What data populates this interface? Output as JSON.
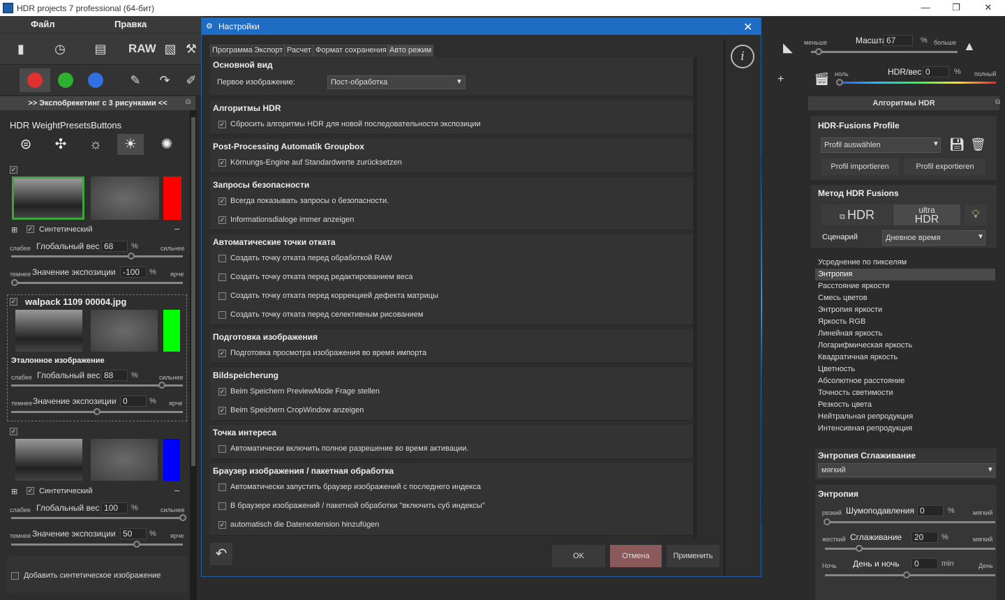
{
  "window": {
    "title": "HDR projects 7 professional (64-бит)",
    "minimize": "—",
    "restore": "❐",
    "close": "✕"
  },
  "menu": {
    "file": "Файл",
    "edit": "Правка"
  },
  "toolbar": {
    "raw_label": "RAW"
  },
  "left": {
    "expo_header": ">> Экспобрекетинг с 3 рисунками <<",
    "presets_title": "HDR WeightPresetsButtons",
    "image1": {
      "synthetic_label": "Синтетический",
      "weaker": "слабее",
      "stronger": "сильнее",
      "global_weight_label": "Глобальный вес",
      "global_weight": "68",
      "pct": "%",
      "darker": "темнее",
      "brighter": "ярче",
      "exposure_label": "Значение экспозиции",
      "exposure": "-100",
      "weight_fraction": 0.7,
      "exposure_fraction": 0.02
    },
    "image2": {
      "filename": "walpack 1109 00004.jpg",
      "reference_label": "Эталонное изображение",
      "weaker": "слабее",
      "stronger": "сильнее",
      "global_weight_label": "Глобальный вес",
      "global_weight": "88",
      "pct": "%",
      "darker": "темнее",
      "brighter": "ярче",
      "exposure_label": "Значение экспозиции",
      "exposure": "0",
      "weight_fraction": 0.88,
      "exposure_fraction": 0.5
    },
    "image3": {
      "synthetic_label": "Синтетический",
      "weaker": "слабее",
      "stronger": "сильнее",
      "global_weight_label": "Глобальный вес",
      "global_weight": "100",
      "pct": "%",
      "darker": "темнее",
      "brighter": "ярче",
      "exposure_label": "Значение экспозиции",
      "exposure": "50",
      "weight_fraction": 1.0,
      "exposure_fraction": 0.73
    },
    "add_synthetic": "Добавить синтетическое изображение"
  },
  "right": {
    "less": "меньше",
    "more": "больше",
    "scale_label": "Масштаб",
    "scale_value": "67",
    "pct": "%",
    "zero": "ноль",
    "full": "полный",
    "hdr_weight_label": "HDR/вес",
    "hdr_weight_value": "0",
    "algorithms_header": "Алгоритмы HDR",
    "profile_title": "HDR-Fusions Profile",
    "profile_select": "Profil auswählen",
    "profile_import": "Profil importieren",
    "profile_export": "Profil exportieren",
    "method_title": "Метод HDR Fusions",
    "method_hdr": "HDR",
    "method_ultra": "ultra",
    "method_ultra_hdr": "HDR",
    "scenario_label": "Сценарий",
    "scenario_value": "Дневное время",
    "algorithms": [
      "Усреднение по пикселям",
      "Энтропия",
      "Расстояние яркости",
      "Смесь цветов",
      "Энтропия яркости",
      "Яркость RGB",
      "Линейная яркость",
      "Логарифмическая яркость",
      "Квадратичная яркость",
      "Цветность",
      "Абсолютное расстояние",
      "Точность светимости",
      "Резкость цвета",
      "Нейтральная репродукция",
      "Интенсивная репродукция"
    ],
    "selected_algorithm": "Энтропия",
    "smoothing_title": "Энтропия Сглаживание",
    "smoothing_value": "мягкий",
    "entropy_title": "Энтропия",
    "sharp": "резкий",
    "soft": "мягкий",
    "hard": "жесткий",
    "noise_label": "Шумоподавления",
    "noise_value": "0",
    "smooth_label": "Сглаживание",
    "smooth_value": "20",
    "night": "Ночь",
    "day": "День",
    "daynight_label": "День и ночь",
    "daynight_value": "0",
    "min": "min"
  },
  "dialog": {
    "title": "Настройки",
    "tabs": [
      "Программа",
      "Экспорт",
      "Расчет",
      "Формат сохранения",
      "Авто режим"
    ],
    "groups": {
      "main_view": "Основной вид",
      "first_image_label": "Первое изображение:",
      "first_image_value": "Пост-обработка",
      "hdr_algo": "Алгоритмы HDR",
      "hdr_algo_item": "Сбросить алгоритмы HDR для новой последовательности экспозиции",
      "postproc": "Post-Processing Automatik Groupbox",
      "postproc_item": "Körnungs-Engine auf Standardwerte zurücksetzen",
      "safety": "Запросы безопасности",
      "safety_item1": "Всегда показывать запросы о безопасности.",
      "safety_item2": "Informationsdialoge immer anzeigen",
      "rollback": "Автоматические точки отката",
      "rollback_item1": "Создать точку отката перед обработкой RAW",
      "rollback_item2": "Создать точку отката перед редактированием веса",
      "rollback_item3": "Создать точку отката перед коррекцией дефекта матрицы",
      "rollback_item4": "Создать точку отката перед селективным рисованием",
      "prep": "Подготовка изображения",
      "prep_item": "Подготовка просмотра изображения во время импорта",
      "bild": "Bildspeicherung",
      "bild_item1": "Beim Speichern PreviewMode Frage stellen",
      "bild_item2": "Beim Speichern CropWindow anzeigen",
      "poi": "Точка интереса",
      "poi_item": "Автоматически включить полное разрешение во время активации.",
      "browser": "Браузер изображения / пакетная обработка",
      "browser_item1": "Автоматически запустить браузер изображений с последнего индекса",
      "browser_item2": "В браузере изображений / пакетной обработки \"включить суб индексы\"",
      "browser_item3": "automatisch die Datenextension hinzufügen"
    },
    "ok": "OK",
    "cancel": "Отмена",
    "apply": "Применить",
    "info": "i"
  }
}
